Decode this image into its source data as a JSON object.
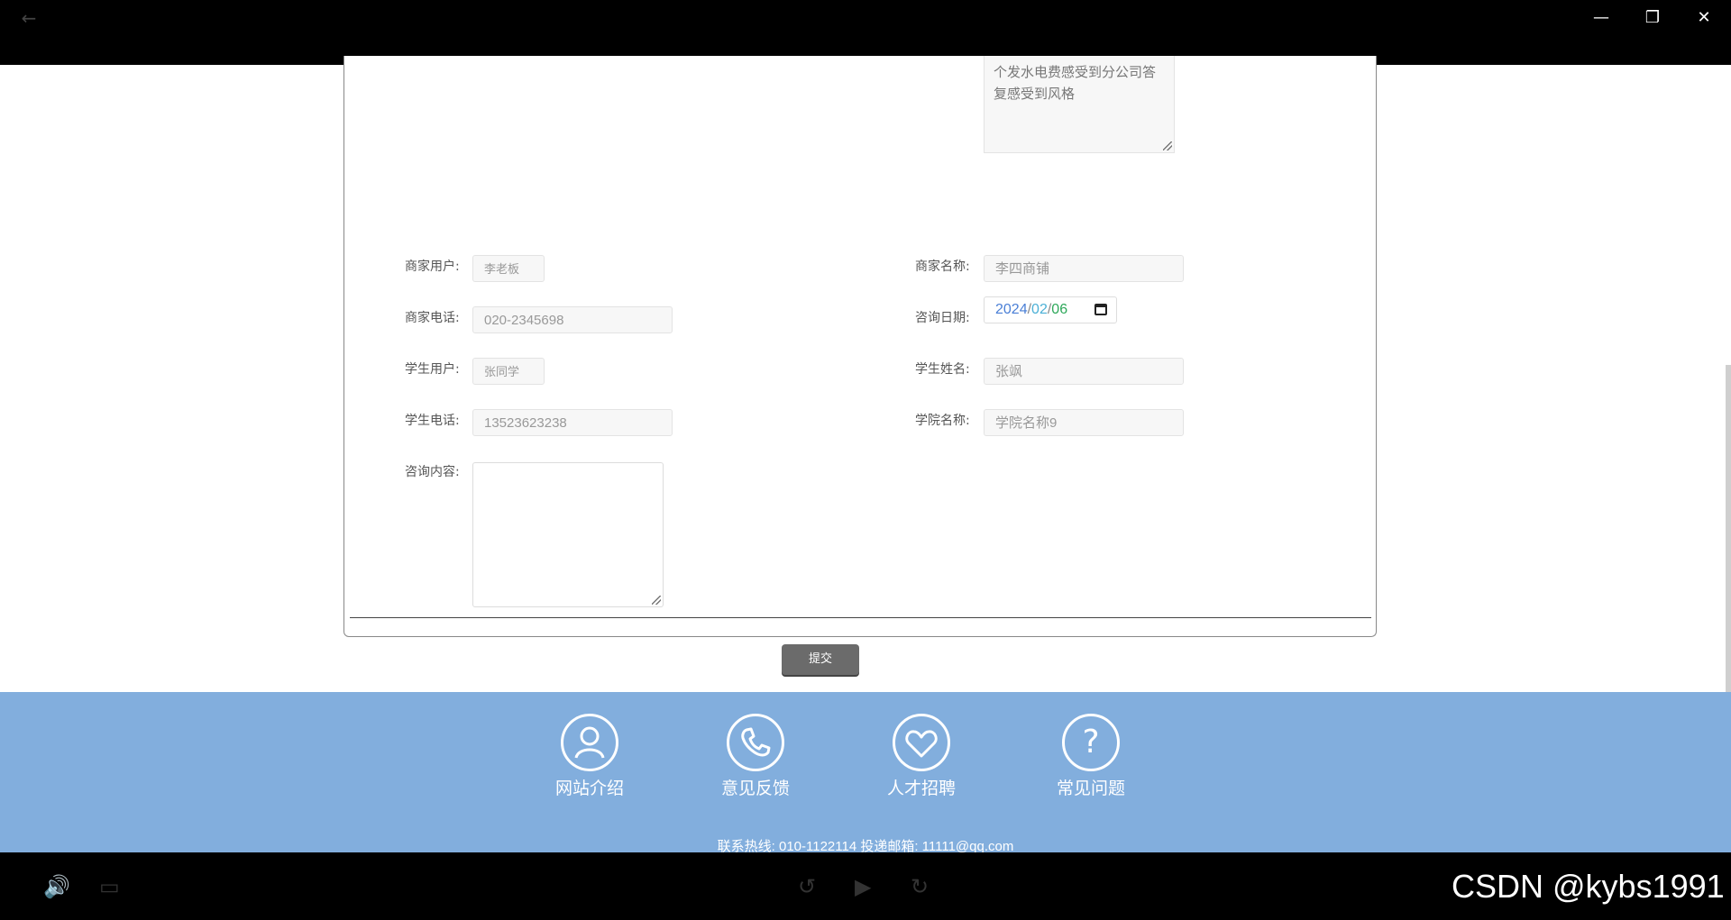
{
  "window": {
    "back_icon": "←",
    "minimize_icon": "—",
    "restore_icon": "❐",
    "close_icon": "✕"
  },
  "form": {
    "prev_textarea_text": "个发水电费感受到分公司答复感受到风格",
    "merchant_user": {
      "label": "商家用户:",
      "value": "李老板"
    },
    "merchant_name": {
      "label": "商家名称:",
      "value": "李四商铺"
    },
    "merchant_phone": {
      "label": "商家电话:",
      "value": "020-2345698"
    },
    "consult_date": {
      "label": "咨询日期:",
      "year": "2024",
      "month": "02",
      "day": "06",
      "sep": "/"
    },
    "student_user": {
      "label": "学生用户:",
      "value": "张同学"
    },
    "student_name": {
      "label": "学生姓名:",
      "value": "张飒"
    },
    "student_phone": {
      "label": "学生电话:",
      "value": "13523623238"
    },
    "college_name": {
      "label": "学院名称:",
      "value": "学院名称9"
    },
    "consult_content": {
      "label": "咨询内容:",
      "value": ""
    },
    "submit_label": "提交"
  },
  "footer": {
    "items": [
      {
        "label": "网站介绍",
        "icon": "person-icon"
      },
      {
        "label": "意见反馈",
        "icon": "phone-icon"
      },
      {
        "label": "人才招聘",
        "icon": "heart-icon"
      },
      {
        "label": "常见问题",
        "icon": "question-icon"
      }
    ],
    "hotline": "联系热线: 010-1122114 投递邮箱: 11111@qq.com"
  },
  "watermark": "CSDN @kybs1991",
  "colors": {
    "footer_bg": "#82aedd",
    "submit_bg": "#6b6b6b"
  }
}
